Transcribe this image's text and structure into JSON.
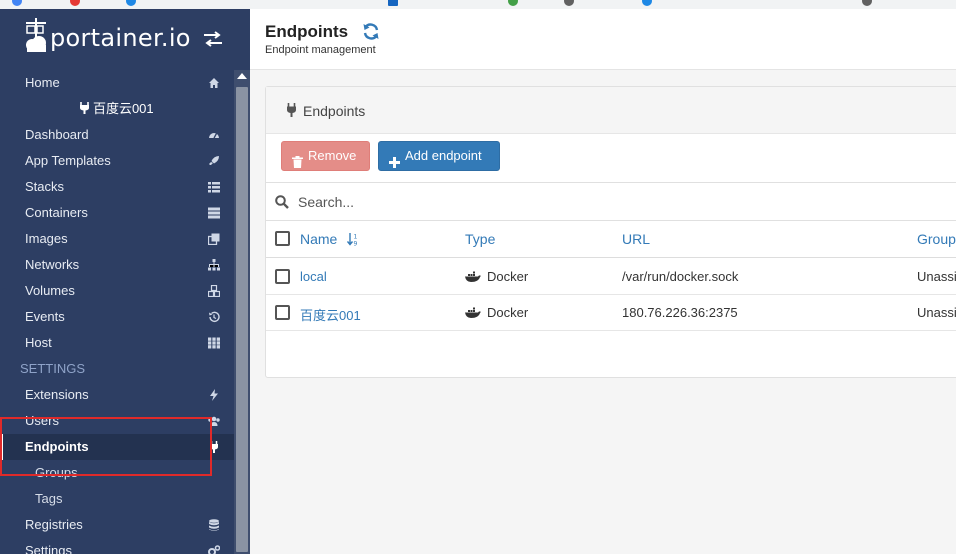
{
  "brand": {
    "name": "portainer.io"
  },
  "sidebar": {
    "items": [
      {
        "label": "Home",
        "icon": "home-icon"
      },
      {
        "label": "Dashboard",
        "icon": "dashboard-icon"
      },
      {
        "label": "App Templates",
        "icon": "rocket-icon"
      },
      {
        "label": "Stacks",
        "icon": "list-icon"
      },
      {
        "label": "Containers",
        "icon": "server-icon"
      },
      {
        "label": "Images",
        "icon": "clone-icon"
      },
      {
        "label": "Networks",
        "icon": "sitemap-icon"
      },
      {
        "label": "Volumes",
        "icon": "cubes-icon"
      },
      {
        "label": "Events",
        "icon": "history-icon"
      },
      {
        "label": "Host",
        "icon": "th-icon"
      }
    ],
    "endpoint_name": "百度云001",
    "settings_label": "SETTINGS",
    "settings_items": [
      {
        "label": "Extensions",
        "icon": "bolt-icon"
      },
      {
        "label": "Users",
        "icon": "users-icon"
      },
      {
        "label": "Endpoints",
        "icon": "plug-icon",
        "active": true
      },
      {
        "label": "Groups",
        "sub": true
      },
      {
        "label": "Tags",
        "sub": true
      },
      {
        "label": "Registries",
        "icon": "database-icon"
      },
      {
        "label": "Settings",
        "icon": "cogs-icon"
      }
    ]
  },
  "header": {
    "title": "Endpoints",
    "subtitle": "Endpoint management"
  },
  "panel": {
    "title": "Endpoints",
    "remove_label": "Remove",
    "add_label": "Add endpoint",
    "search_placeholder": "Search...",
    "columns": [
      "Name",
      "Type",
      "URL",
      "Group"
    ],
    "rows": [
      {
        "name": "local",
        "type": "Docker",
        "url": "/var/run/docker.sock",
        "group": "Unassigned"
      },
      {
        "name": "百度云001",
        "type": "Docker",
        "url": "180.76.226.36:2375",
        "group": "Unassigned"
      }
    ]
  },
  "colors": {
    "sidebar_bg": "#2d3e63",
    "primary": "#337ab7",
    "danger_disabled": "#e48d88",
    "highlight": "#e02a2a"
  }
}
